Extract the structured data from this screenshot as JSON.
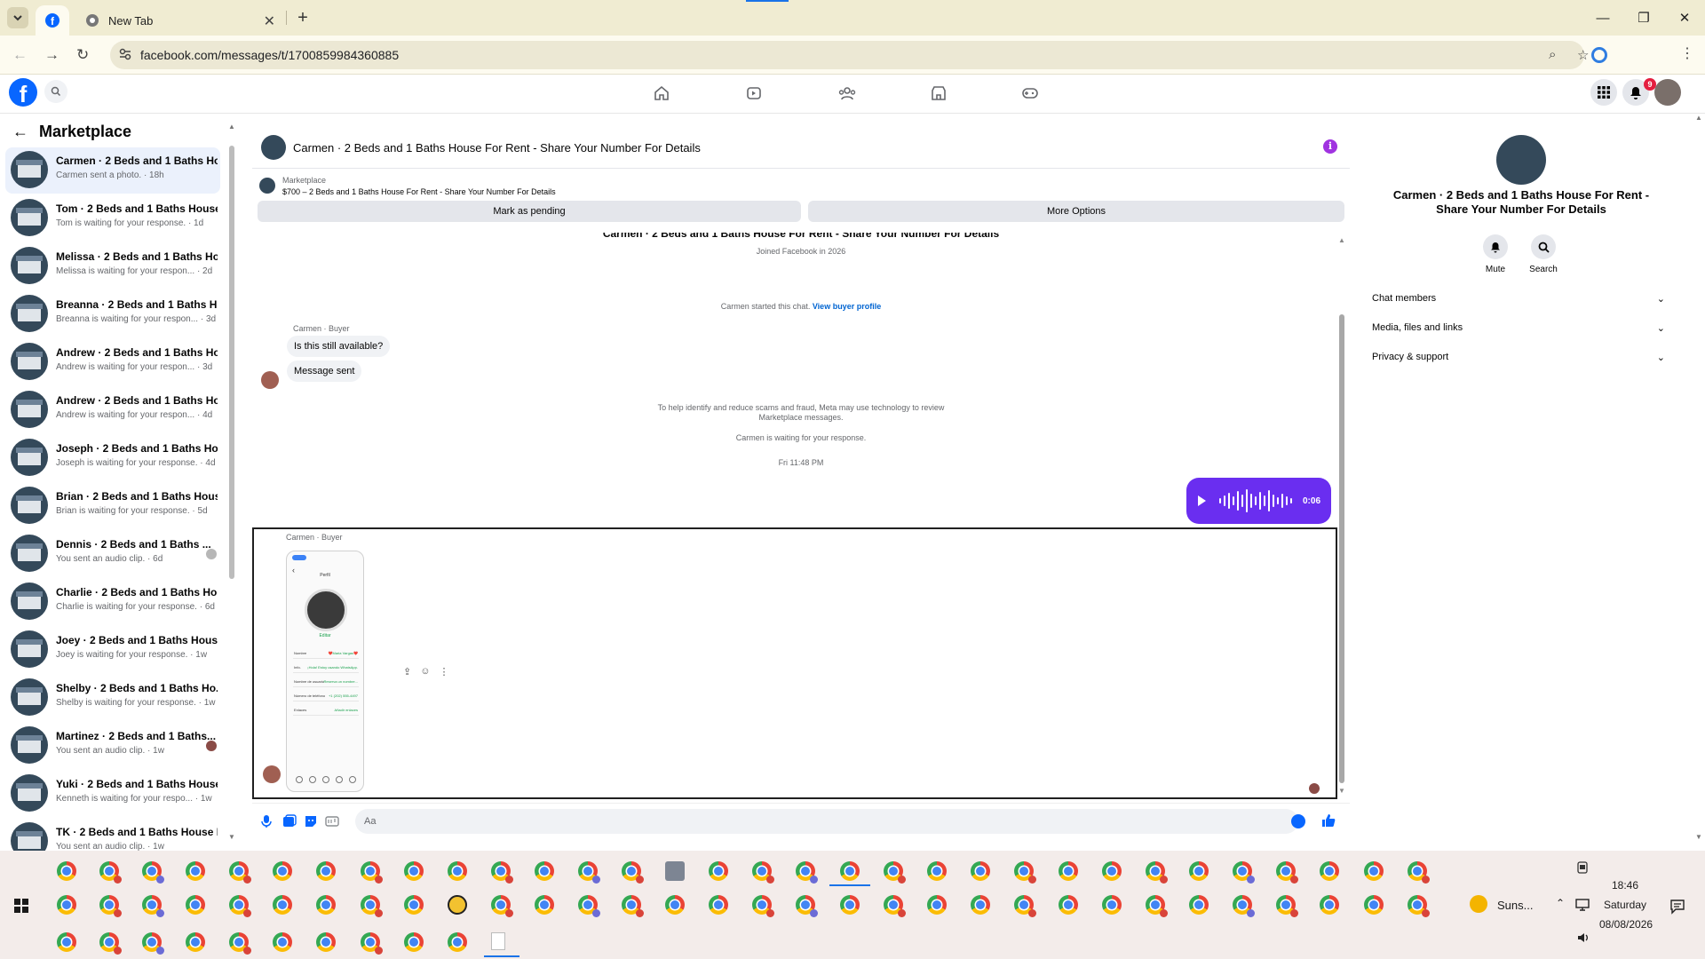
{
  "browser": {
    "tabs": [
      {
        "title": ""
      },
      {
        "title": "New Tab"
      }
    ],
    "url": "facebook.com/messages/t/1700859984360885"
  },
  "fb": {
    "notification_count": "9"
  },
  "sidebar": {
    "title": "Marketplace",
    "conversations": [
      {
        "name": "Carmen · 2 Beds and 1 Baths Ho...",
        "status": "Carmen sent a photo. · 18h",
        "active": true
      },
      {
        "name": "Tom · 2 Beds and 1 Baths House...",
        "status": "Tom is waiting for your response. · 1d"
      },
      {
        "name": "Melissa · 2 Beds and 1 Baths Ho...",
        "status": "Melissa is waiting for your respon... · 2d"
      },
      {
        "name": "Breanna · 2 Beds and 1 Baths H...",
        "status": "Breanna is waiting for your respon... · 3d"
      },
      {
        "name": "Andrew · 2 Beds and 1 Baths Ho...",
        "status": "Andrew is waiting for your respon... · 3d"
      },
      {
        "name": "Andrew · 2 Beds and 1 Baths Ho...",
        "status": "Andrew is waiting for your respon... · 4d"
      },
      {
        "name": "Joseph · 2 Beds and 1 Baths Ho...",
        "status": "Joseph is waiting for your response. · 4d"
      },
      {
        "name": "Brian · 2 Beds and 1 Baths Hous...",
        "status": "Brian is waiting for your response. · 5d"
      },
      {
        "name": "Dennis · 2 Beds and 1 Baths ...",
        "status": "You sent an audio clip. · 6d"
      },
      {
        "name": "Charlie · 2 Beds and 1 Baths Ho...",
        "status": "Charlie is waiting for your response. · 6d"
      },
      {
        "name": "Joey · 2 Beds and 1 Baths Hous...",
        "status": "Joey is waiting for your response. · 1w"
      },
      {
        "name": "Shelby · 2 Beds and 1 Baths Ho...",
        "status": "Shelby is waiting for your response. · 1w"
      },
      {
        "name": "Martinez · 2 Beds and 1 Baths...",
        "status": "You sent an audio clip. · 1w"
      },
      {
        "name": "Yuki · 2 Beds and 1 Baths House...",
        "status": "Kenneth is waiting for your respo... · 1w"
      },
      {
        "name": "TK · 2 Beds and 1 Baths House F...",
        "status": "You sent an audio clip. · 1w"
      }
    ]
  },
  "chat": {
    "title": "Carmen · 2 Beds and 1 Baths House For Rent - Share Your Number For Details",
    "listing_source": "Marketplace",
    "listing_title": "$700 – 2 Beds and 1 Baths House For Rent - Share Your Number For Details",
    "mark_pending": "Mark as pending",
    "more_options": "More Options",
    "cut_title": "Carmen · 2 Beds and 1 Baths House For Rent - Share Your Number For Details",
    "joined": "Joined Facebook in 2026",
    "started": "Carmen started this chat.",
    "view_profile": "View buyer profile",
    "sender1": "Carmen · Buyer",
    "msg1": "Is this still available?",
    "msg2": "Message sent",
    "notice1": "To help identify and reduce scams and fraud, Meta may use technology to review",
    "notice2": "Marketplace messages.",
    "waiting": "Carmen is waiting for your response.",
    "timestamp": "Fri 11:48 PM",
    "audio_duration": "0:06",
    "sender2": "Carmen · Buyer",
    "placeholder": "Aa",
    "shot": {
      "profile_title": "Perfil",
      "edit": "Editar",
      "rows": [
        {
          "label": "Nombre",
          "value": "❤️Maria Vargas❤️"
        },
        {
          "label": "Info.",
          "value": "¡Hola! Estoy usando WhatsApp."
        },
        {
          "label": "Nombre de usuario",
          "value": "Reserva un nombre..."
        },
        {
          "label": "Número de teléfono",
          "value": "+1 (202) 555-4497"
        },
        {
          "label": "Enlaces",
          "value": "Añadir enlaces"
        }
      ]
    }
  },
  "panel": {
    "name": "Carmen · 2 Beds and 1 Baths House For Rent - Share Your Number For Details",
    "mute": "Mute",
    "search": "Search",
    "sections": [
      "Chat members",
      "Media, files and links",
      "Privacy & support"
    ]
  },
  "taskbar": {
    "weather": "Suns...",
    "time": "18:46",
    "day": "Saturday",
    "date": "08/08/2026"
  },
  "colors": {
    "fb_blue": "#0866ff",
    "audio_bubble": "#6a2ef0",
    "info_purple": "#a033e0",
    "badge_red": "#e41e3f"
  }
}
